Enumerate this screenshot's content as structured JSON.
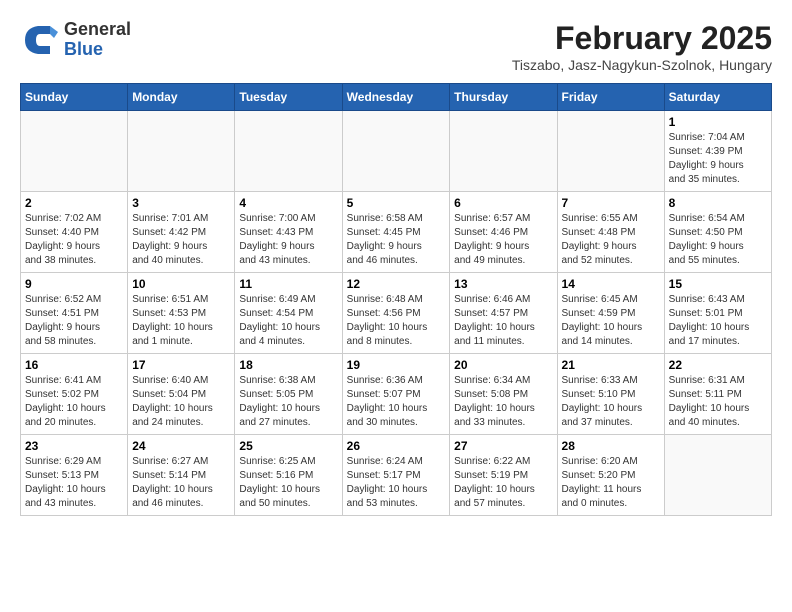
{
  "header": {
    "logo_general": "General",
    "logo_blue": "Blue",
    "month_title": "February 2025",
    "subtitle": "Tiszabo, Jasz-Nagykun-Szolnok, Hungary"
  },
  "weekdays": [
    "Sunday",
    "Monday",
    "Tuesday",
    "Wednesday",
    "Thursday",
    "Friday",
    "Saturday"
  ],
  "weeks": [
    [
      {
        "day": "",
        "detail": ""
      },
      {
        "day": "",
        "detail": ""
      },
      {
        "day": "",
        "detail": ""
      },
      {
        "day": "",
        "detail": ""
      },
      {
        "day": "",
        "detail": ""
      },
      {
        "day": "",
        "detail": ""
      },
      {
        "day": "1",
        "detail": "Sunrise: 7:04 AM\nSunset: 4:39 PM\nDaylight: 9 hours\nand 35 minutes."
      }
    ],
    [
      {
        "day": "2",
        "detail": "Sunrise: 7:02 AM\nSunset: 4:40 PM\nDaylight: 9 hours\nand 38 minutes."
      },
      {
        "day": "3",
        "detail": "Sunrise: 7:01 AM\nSunset: 4:42 PM\nDaylight: 9 hours\nand 40 minutes."
      },
      {
        "day": "4",
        "detail": "Sunrise: 7:00 AM\nSunset: 4:43 PM\nDaylight: 9 hours\nand 43 minutes."
      },
      {
        "day": "5",
        "detail": "Sunrise: 6:58 AM\nSunset: 4:45 PM\nDaylight: 9 hours\nand 46 minutes."
      },
      {
        "day": "6",
        "detail": "Sunrise: 6:57 AM\nSunset: 4:46 PM\nDaylight: 9 hours\nand 49 minutes."
      },
      {
        "day": "7",
        "detail": "Sunrise: 6:55 AM\nSunset: 4:48 PM\nDaylight: 9 hours\nand 52 minutes."
      },
      {
        "day": "8",
        "detail": "Sunrise: 6:54 AM\nSunset: 4:50 PM\nDaylight: 9 hours\nand 55 minutes."
      }
    ],
    [
      {
        "day": "9",
        "detail": "Sunrise: 6:52 AM\nSunset: 4:51 PM\nDaylight: 9 hours\nand 58 minutes."
      },
      {
        "day": "10",
        "detail": "Sunrise: 6:51 AM\nSunset: 4:53 PM\nDaylight: 10 hours\nand 1 minute."
      },
      {
        "day": "11",
        "detail": "Sunrise: 6:49 AM\nSunset: 4:54 PM\nDaylight: 10 hours\nand 4 minutes."
      },
      {
        "day": "12",
        "detail": "Sunrise: 6:48 AM\nSunset: 4:56 PM\nDaylight: 10 hours\nand 8 minutes."
      },
      {
        "day": "13",
        "detail": "Sunrise: 6:46 AM\nSunset: 4:57 PM\nDaylight: 10 hours\nand 11 minutes."
      },
      {
        "day": "14",
        "detail": "Sunrise: 6:45 AM\nSunset: 4:59 PM\nDaylight: 10 hours\nand 14 minutes."
      },
      {
        "day": "15",
        "detail": "Sunrise: 6:43 AM\nSunset: 5:01 PM\nDaylight: 10 hours\nand 17 minutes."
      }
    ],
    [
      {
        "day": "16",
        "detail": "Sunrise: 6:41 AM\nSunset: 5:02 PM\nDaylight: 10 hours\nand 20 minutes."
      },
      {
        "day": "17",
        "detail": "Sunrise: 6:40 AM\nSunset: 5:04 PM\nDaylight: 10 hours\nand 24 minutes."
      },
      {
        "day": "18",
        "detail": "Sunrise: 6:38 AM\nSunset: 5:05 PM\nDaylight: 10 hours\nand 27 minutes."
      },
      {
        "day": "19",
        "detail": "Sunrise: 6:36 AM\nSunset: 5:07 PM\nDaylight: 10 hours\nand 30 minutes."
      },
      {
        "day": "20",
        "detail": "Sunrise: 6:34 AM\nSunset: 5:08 PM\nDaylight: 10 hours\nand 33 minutes."
      },
      {
        "day": "21",
        "detail": "Sunrise: 6:33 AM\nSunset: 5:10 PM\nDaylight: 10 hours\nand 37 minutes."
      },
      {
        "day": "22",
        "detail": "Sunrise: 6:31 AM\nSunset: 5:11 PM\nDaylight: 10 hours\nand 40 minutes."
      }
    ],
    [
      {
        "day": "23",
        "detail": "Sunrise: 6:29 AM\nSunset: 5:13 PM\nDaylight: 10 hours\nand 43 minutes."
      },
      {
        "day": "24",
        "detail": "Sunrise: 6:27 AM\nSunset: 5:14 PM\nDaylight: 10 hours\nand 46 minutes."
      },
      {
        "day": "25",
        "detail": "Sunrise: 6:25 AM\nSunset: 5:16 PM\nDaylight: 10 hours\nand 50 minutes."
      },
      {
        "day": "26",
        "detail": "Sunrise: 6:24 AM\nSunset: 5:17 PM\nDaylight: 10 hours\nand 53 minutes."
      },
      {
        "day": "27",
        "detail": "Sunrise: 6:22 AM\nSunset: 5:19 PM\nDaylight: 10 hours\nand 57 minutes."
      },
      {
        "day": "28",
        "detail": "Sunrise: 6:20 AM\nSunset: 5:20 PM\nDaylight: 11 hours\nand 0 minutes."
      },
      {
        "day": "",
        "detail": ""
      }
    ]
  ]
}
